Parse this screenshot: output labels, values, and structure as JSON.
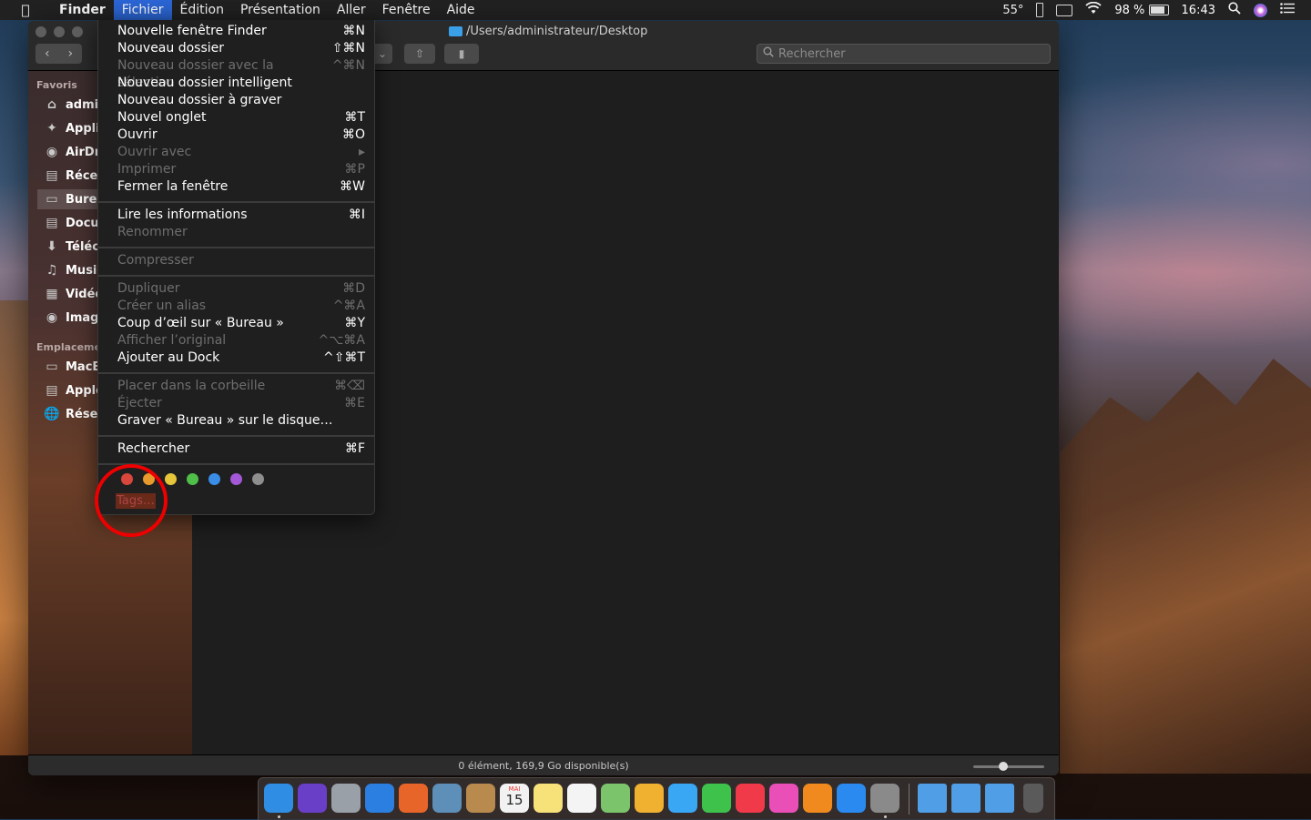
{
  "menubar": {
    "app": "Finder",
    "items": [
      "Fichier",
      "Édition",
      "Présentation",
      "Aller",
      "Fenêtre",
      "Aide"
    ],
    "active": "Fichier",
    "status": {
      "temperature": "55°",
      "battery": "98 %",
      "time": "16:43"
    }
  },
  "window": {
    "path": "/Users/administrateur/Desktop",
    "search_placeholder": "Rechercher",
    "status": "0 élément, 169,9 Go disponible(s)"
  },
  "sidebar": {
    "favorites_label": "Favoris",
    "favorites": [
      {
        "label": "admir",
        "icon": "home-icon"
      },
      {
        "label": "Appli",
        "icon": "applications-icon"
      },
      {
        "label": "AirDr",
        "icon": "airdrop-icon"
      },
      {
        "label": "Récer",
        "icon": "recents-icon"
      },
      {
        "label": "Burea",
        "icon": "desktop-icon",
        "selected": true
      },
      {
        "label": "Docu",
        "icon": "documents-icon"
      },
      {
        "label": "Téléc",
        "icon": "downloads-icon"
      },
      {
        "label": "Music",
        "icon": "music-icon"
      },
      {
        "label": "Vidéo",
        "icon": "movies-icon"
      },
      {
        "label": "Image",
        "icon": "pictures-icon"
      }
    ],
    "locations_label": "Emplacemer",
    "locations": [
      {
        "label": "MacB",
        "icon": "laptop-icon"
      },
      {
        "label": "Apple",
        "icon": "disk-icon"
      },
      {
        "label": "Résea",
        "icon": "network-icon"
      }
    ]
  },
  "file_menu": {
    "groups": [
      [
        {
          "label": "Nouvelle fenêtre Finder",
          "shortcut": "⌘N",
          "enabled": true
        },
        {
          "label": "Nouveau dossier",
          "shortcut": "⇧⌘N",
          "enabled": true
        },
        {
          "label": "Nouveau dossier avec la sélection",
          "shortcut": "^⌘N",
          "enabled": false
        },
        {
          "label": "Nouveau dossier intelligent",
          "shortcut": "",
          "enabled": true
        },
        {
          "label": "Nouveau dossier à graver",
          "shortcut": "",
          "enabled": true
        },
        {
          "label": "Nouvel onglet",
          "shortcut": "⌘T",
          "enabled": true
        },
        {
          "label": "Ouvrir",
          "shortcut": "⌘O",
          "enabled": true
        },
        {
          "label": "Ouvrir avec",
          "shortcut": "▸",
          "enabled": false
        },
        {
          "label": "Imprimer",
          "shortcut": "⌘P",
          "enabled": false
        },
        {
          "label": "Fermer la fenêtre",
          "shortcut": "⌘W",
          "enabled": true
        }
      ],
      [
        {
          "label": "Lire les informations",
          "shortcut": "⌘I",
          "enabled": true
        },
        {
          "label": "Renommer",
          "shortcut": "",
          "enabled": false
        }
      ],
      [
        {
          "label": "Compresser",
          "shortcut": "",
          "enabled": false
        }
      ],
      [
        {
          "label": "Dupliquer",
          "shortcut": "⌘D",
          "enabled": false
        },
        {
          "label": "Créer un alias",
          "shortcut": "^⌘A",
          "enabled": false
        },
        {
          "label": "Coup d’œil sur « Bureau »",
          "shortcut": "⌘Y",
          "enabled": true
        },
        {
          "label": "Afficher l’original",
          "shortcut": "^⌥⌘A",
          "enabled": false
        },
        {
          "label": "Ajouter au Dock",
          "shortcut": "^⇧⌘T",
          "enabled": true
        }
      ],
      [
        {
          "label": "Placer dans la corbeille",
          "shortcut": "⌘⌫",
          "enabled": false
        },
        {
          "label": "Éjecter",
          "shortcut": "⌘E",
          "enabled": false
        },
        {
          "label": "Graver « Bureau » sur le disque…",
          "shortcut": "",
          "enabled": true
        }
      ],
      [
        {
          "label": "Rechercher",
          "shortcut": "⌘F",
          "enabled": true
        }
      ]
    ],
    "tag_colors": [
      "#d9463b",
      "#e89a2c",
      "#e6c53a",
      "#4fbf4a",
      "#3a8ee8",
      "#a358d6",
      "#8e8e8e"
    ],
    "tags_label": "Tags…"
  },
  "dock": {
    "apps": [
      {
        "name": "finder-icon",
        "color": "#2f8de4",
        "running": true
      },
      {
        "name": "siri-icon",
        "color": "#6a3fc8"
      },
      {
        "name": "launchpad-icon",
        "color": "#9aa0a8"
      },
      {
        "name": "safari-icon",
        "color": "#2a7fe0"
      },
      {
        "name": "firefox-icon",
        "color": "#e8652a"
      },
      {
        "name": "preview-icon",
        "color": "#5d8fb8"
      },
      {
        "name": "contacts-icon",
        "color": "#b88a4e"
      },
      {
        "name": "calendar-icon",
        "color": "#f2f2f2"
      },
      {
        "name": "notes-icon",
        "color": "#f7e27a"
      },
      {
        "name": "reminders-icon",
        "color": "#f4f4f4"
      },
      {
        "name": "maps-icon",
        "color": "#7cc46b"
      },
      {
        "name": "photos-icon",
        "color": "#f0b030"
      },
      {
        "name": "messages-icon",
        "color": "#3aa7f4"
      },
      {
        "name": "facetime-icon",
        "color": "#3ec24b"
      },
      {
        "name": "news-icon",
        "color": "#f03a4a"
      },
      {
        "name": "itunes-icon",
        "color": "#e94fb6"
      },
      {
        "name": "books-icon",
        "color": "#f08a1e"
      },
      {
        "name": "appstore-icon",
        "color": "#2a8af0"
      },
      {
        "name": "system-preferences-icon",
        "color": "#8a8a8a",
        "running": true
      }
    ],
    "calendar": {
      "month": "MAI",
      "day": "15"
    },
    "stacks": [
      {
        "name": "applications-folder-icon",
        "color": "#4f9ee6"
      },
      {
        "name": "documents-folder-icon",
        "color": "#4f9ee6"
      },
      {
        "name": "downloads-folder-icon",
        "color": "#4f9ee6"
      },
      {
        "name": "trash-icon",
        "color": "#5a5a5a"
      }
    ]
  }
}
